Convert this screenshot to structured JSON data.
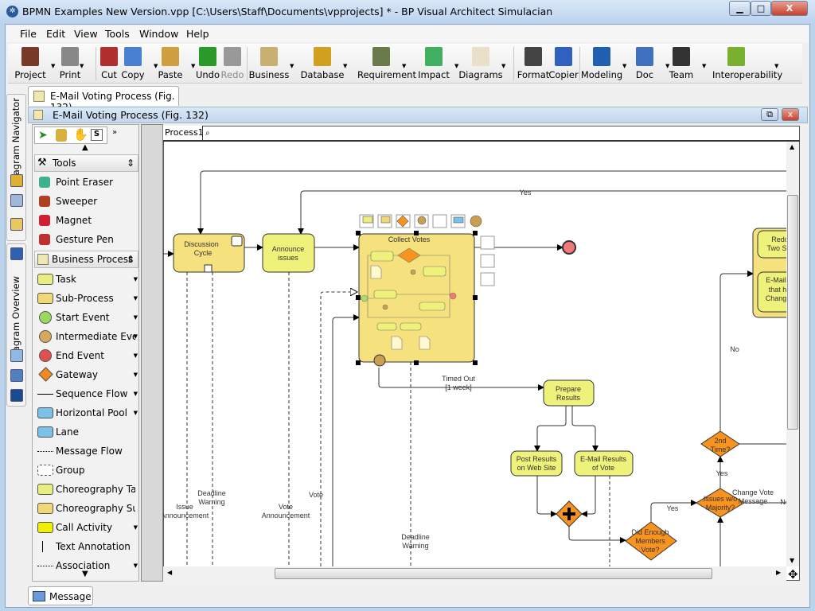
{
  "window": {
    "title": "BPMN Examples New Version.vpp [C:\\Users\\Staff\\Documents\\vpprojects] * - BP Visual Architect Simulacian",
    "minimize": "▁",
    "maximize": "□",
    "close": "X"
  },
  "menu": [
    "File",
    "Edit",
    "View",
    "Tools",
    "Window",
    "Help"
  ],
  "toolbar": [
    {
      "label": "Project",
      "icon": "project-icon",
      "color": "#7a3a2a"
    },
    {
      "label": "Print",
      "icon": "print-icon",
      "color": "#888888"
    },
    {
      "label": "Cut",
      "icon": "scissors-icon",
      "color": "#b03030"
    },
    {
      "label": "Copy",
      "icon": "copy-icon",
      "color": "#4a80d0"
    },
    {
      "label": "Paste",
      "icon": "paste-icon",
      "color": "#d0a040"
    },
    {
      "label": "Undo",
      "icon": "undo-icon",
      "color": "#2a9a2a"
    },
    {
      "label": "Redo",
      "icon": "redo-icon",
      "color": "#999999"
    },
    {
      "label": "Business",
      "icon": "business-icon",
      "color": "#c8b070"
    },
    {
      "label": "Database",
      "icon": "database-icon",
      "color": "#d0a020"
    },
    {
      "label": "Requirement",
      "icon": "requirement-icon",
      "color": "#6a7a4a"
    },
    {
      "label": "Impact",
      "icon": "impact-icon",
      "color": "#40b060"
    },
    {
      "label": "Diagrams",
      "icon": "diagrams-icon",
      "color": "#e8e0c8"
    },
    {
      "label": "Format",
      "icon": "format-icon",
      "color": "#444444"
    },
    {
      "label": "Copier",
      "icon": "copier-icon",
      "color": "#3060c0"
    },
    {
      "label": "Modeling",
      "icon": "modeling-icon",
      "color": "#2060b0"
    },
    {
      "label": "Doc",
      "icon": "doc-icon",
      "color": "#4070c0"
    },
    {
      "label": "Team",
      "icon": "team-icon",
      "color": "#333333"
    },
    {
      "label": "Interoperability",
      "icon": "interoperability-icon",
      "color": "#7ab030"
    }
  ],
  "side_tabs": [
    "Diagram Navigator",
    "Diagram Overview"
  ],
  "doc_tab": "E-Mail Voting Process (Fig. 132)",
  "inner_title": "E-Mail Voting Process (Fig. 132)",
  "palette": {
    "tools_header": "Tools",
    "tools": [
      "Point Eraser",
      "Sweeper",
      "Magnet",
      "Gesture Pen"
    ],
    "bp_header": "Business Process",
    "items": [
      {
        "label": "Task",
        "color": "#e8ee80",
        "more": true
      },
      {
        "label": "Sub-Process",
        "color": "#f0d878",
        "more": true
      },
      {
        "label": "Start Event",
        "color": "#9ad860",
        "more": true
      },
      {
        "label": "Intermediate Event",
        "color": "#d8a860",
        "more": true
      },
      {
        "label": "End Event",
        "color": "#e05050",
        "more": true
      },
      {
        "label": "Gateway",
        "color": "#f08a20",
        "more": true
      },
      {
        "label": "Sequence Flow",
        "color": "#000000",
        "more": true
      },
      {
        "label": "Horizontal Pool",
        "color": "#7ac0e8",
        "more": true
      },
      {
        "label": "Lane",
        "color": "#7ac0e8",
        "more": false
      },
      {
        "label": "Message Flow",
        "color": "#000000",
        "more": false
      },
      {
        "label": "Group",
        "color": "#ffffff",
        "more": false
      },
      {
        "label": "Choreography Task",
        "color": "#e8ee80",
        "more": false
      },
      {
        "label": "Choreography Sub-Pr",
        "color": "#f0d878",
        "more": false
      },
      {
        "label": "Call Activity",
        "color": "#f0f000",
        "more": true
      },
      {
        "label": "Text Annotation",
        "color": "#ffffff",
        "more": false
      },
      {
        "label": "Association",
        "color": "#000000",
        "more": true
      }
    ]
  },
  "canvas_tab": "Process1",
  "diagram": {
    "discussion": [
      "Discussion",
      "Cycle"
    ],
    "announce": [
      "Announce",
      "issues"
    ],
    "collect": "Collect Votes",
    "prepare": [
      "Prepare",
      "Results"
    ],
    "post": [
      "Post Results",
      "on Web Site"
    ],
    "email": [
      "E-Mail Results",
      "of Vote"
    ],
    "did_enough": [
      "Did Enough",
      "Members",
      "Vote?"
    ],
    "issues": [
      "Issues w/o",
      "Majority?"
    ],
    "second": [
      "2nd",
      "Time?"
    ],
    "redo": [
      "Redo",
      "Two S"
    ],
    "email_change": [
      "E-Mail",
      "that h",
      "Chang"
    ],
    "yes_top": "Yes",
    "no_left": "No",
    "yes1": "Yes",
    "yes2": "Yes",
    "change_vote": [
      "Change Vote",
      "Message"
    ],
    "no_right": "No",
    "timed_out": [
      "Timed Out",
      "[1 week]"
    ],
    "issue_ann": [
      "Issue",
      "Announcement"
    ],
    "deadline1": [
      "Deadline",
      "Warning"
    ],
    "vote_ann": [
      "Vote",
      "Announcement"
    ],
    "vote": "Vote",
    "deadline2": [
      "Deadline",
      "Warning"
    ]
  },
  "bottom_tab": "Message"
}
